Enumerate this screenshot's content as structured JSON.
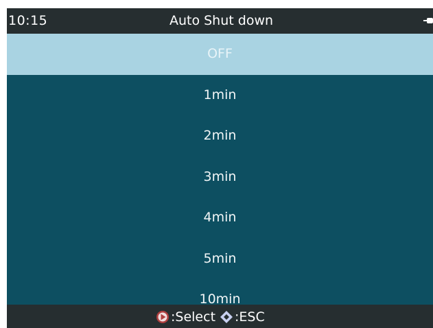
{
  "status": {
    "time": "10:15",
    "title": "Auto Shut down",
    "power_icon": "power-plug-icon"
  },
  "menu": {
    "items": [
      {
        "label": "OFF",
        "selected": true
      },
      {
        "label": "1min",
        "selected": false
      },
      {
        "label": "2min",
        "selected": false
      },
      {
        "label": "3min",
        "selected": false
      },
      {
        "label": "4min",
        "selected": false
      },
      {
        "label": "5min",
        "selected": false
      },
      {
        "label": "10min",
        "selected": false
      }
    ]
  },
  "footer": {
    "select_icon": "right-arrow-button-icon",
    "select_label": ":Select",
    "esc_icon": "diamond-dpad-icon",
    "esc_label": ":ESC"
  },
  "colors": {
    "background": "#0d4f61",
    "highlight": "#a9d3e2",
    "bars": "#262e30",
    "select_icon": "#b04040",
    "esc_icon": "#c8d0f0"
  }
}
